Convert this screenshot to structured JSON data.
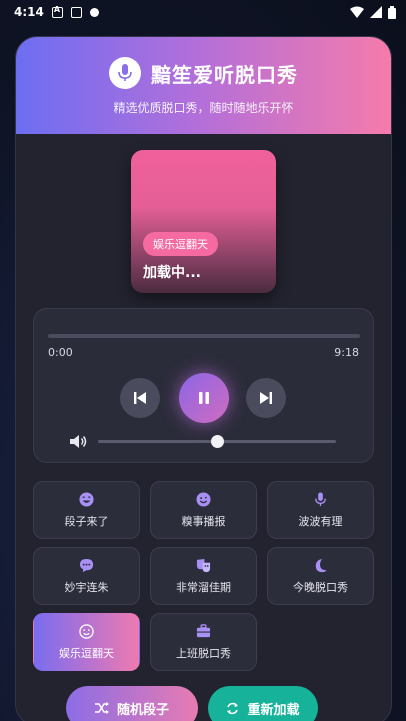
{
  "status_bar": {
    "time": "4:14"
  },
  "header": {
    "title": "黯笙爱听脱口秀",
    "subtitle": "精选优质脱口秀，随时随地乐开怀"
  },
  "now_playing": {
    "category_tag": "娱乐逗翻天",
    "title": "加载中..."
  },
  "player": {
    "current_time": "0:00",
    "duration": "9:18",
    "progress": 0.0,
    "volume": 0.5
  },
  "categories": [
    {
      "label": "段子来了",
      "icon": "laugh-icon",
      "active": false
    },
    {
      "label": "糗事播报",
      "icon": "grin-icon",
      "active": false
    },
    {
      "label": "波波有理",
      "icon": "microphone-icon",
      "active": false
    },
    {
      "label": "妙宇连朱",
      "icon": "chat-bubble-icon",
      "active": false
    },
    {
      "label": "非常溜佳期",
      "icon": "theater-masks-icon",
      "active": false
    },
    {
      "label": "今晚脱口秀",
      "icon": "moon-icon",
      "active": false
    },
    {
      "label": "娱乐逗翻天",
      "icon": "smile-icon",
      "active": true
    },
    {
      "label": "上班脱口秀",
      "icon": "briefcase-icon",
      "active": false
    }
  ],
  "actions": {
    "random_label": "随机段子",
    "reload_label": "重新加载"
  },
  "colors": {
    "accent_purple": "#8b66e6",
    "accent_pink": "#f57bab",
    "teal": "#16b39a",
    "card_bg": "#22232f"
  }
}
